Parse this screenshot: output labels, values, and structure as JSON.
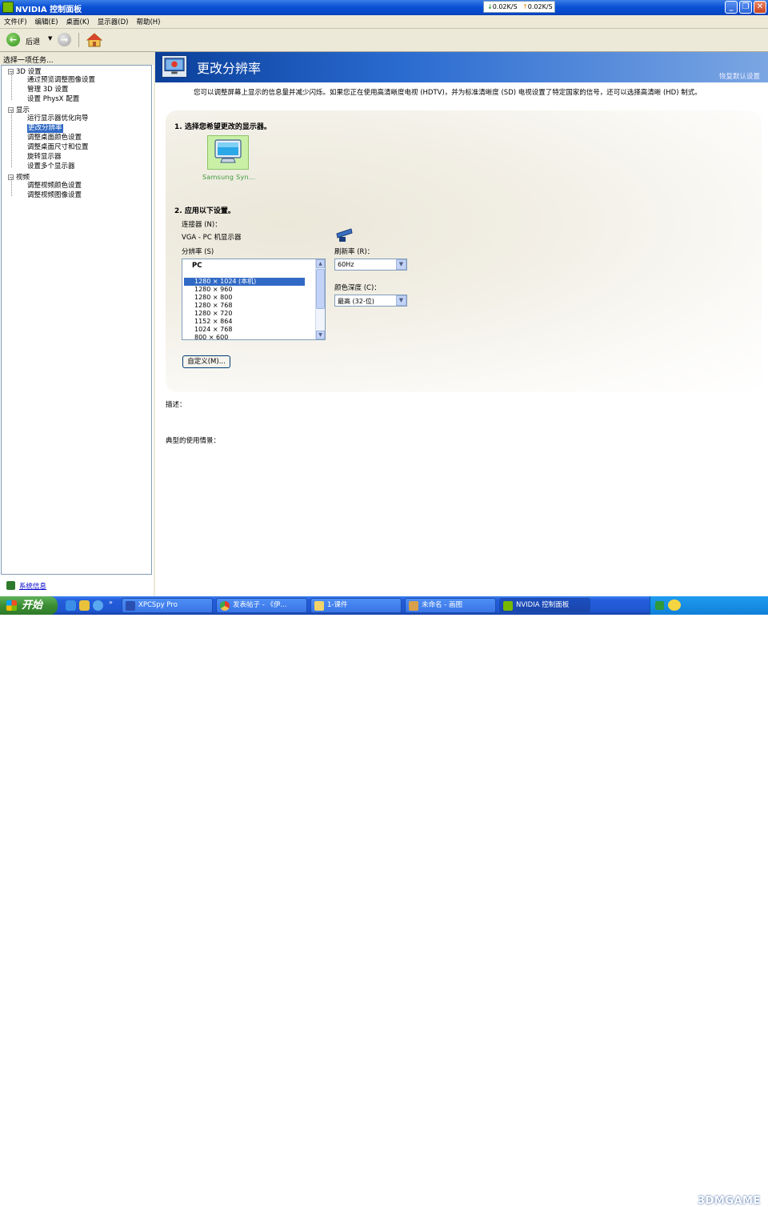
{
  "window": {
    "title": "NVIDIA 控制面板"
  },
  "network": {
    "down": "0.02K/S",
    "up": "0.02K/S"
  },
  "menu": [
    "文件(F)",
    "编辑(E)",
    "桌面(K)",
    "显示器(D)",
    "帮助(H)"
  ],
  "toolbar": {
    "back_label": "后退"
  },
  "sidebar": {
    "header": "选择一项任务...",
    "categories": [
      {
        "label": "3D 设置",
        "children": [
          "通过预览调整图像设置",
          "管理 3D 设置",
          "设置 PhysX 配置"
        ]
      },
      {
        "label": "显示",
        "children": [
          "运行显示器优化向导",
          "更改分辨率",
          "调整桌面颜色设置",
          "调整桌面尺寸和位置",
          "旋转显示器",
          "设置多个显示器"
        ]
      },
      {
        "label": "视频",
        "children": [
          "调整视频颜色设置",
          "调整视频图像设置"
        ]
      }
    ],
    "selected": "更改分辨率",
    "system_info": "系统信息"
  },
  "page": {
    "title": "更改分辨率",
    "restore_defaults": "恢复默认设置",
    "intro": "您可以调整屏幕上显示的信息量并减少闪烁。如果您正在使用高清晰度电视 (HDTV)，并为标准清晰度 (SD) 电视设置了特定国家的信号，还可以选择高清晰 (HD) 制式。",
    "step1": "1. 选择您希望更改的显示器。",
    "display_name": "Samsung Syn...",
    "step2": "2. 应用以下设置。",
    "connector_label": "连接器 (N)：",
    "connector_value": "VGA - PC 机显示器",
    "resolution_label": "分辨率 (S)",
    "resolution_group": "PC",
    "resolutions": [
      "1280 × 1024 (本机)",
      "1280 × 960",
      "1280 × 800",
      "1280 × 768",
      "1280 × 720",
      "1152 × 864",
      "1024 × 768",
      "800 × 600"
    ],
    "selected_resolution": "1280 × 1024 (本机)",
    "refresh_label": "刷新率 (R)：",
    "refresh_value": "60Hz",
    "color_depth_label": "颜色深度 (C)：",
    "color_depth_value": "最高 (32-位)",
    "custom_button": "自定义(M)...",
    "description_label": "描述：",
    "usage_label": "典型的使用情景："
  },
  "taskbar": {
    "start": "开始",
    "tasks": [
      {
        "label": "XPCSpy Pro",
        "active": false
      },
      {
        "label": "发表帖子 - 《伊...",
        "active": false
      },
      {
        "label": "1-课件",
        "active": false
      },
      {
        "label": "未命名 - 画图",
        "active": false
      },
      {
        "label": "NVIDIA 控制面板",
        "active": true
      }
    ],
    "watermark": "3DMGAME"
  },
  "colors": {
    "titlebar": "#0a52d6",
    "selection": "#316ac5",
    "nvidia_green": "#76b900",
    "banner": "#1a55bd"
  }
}
